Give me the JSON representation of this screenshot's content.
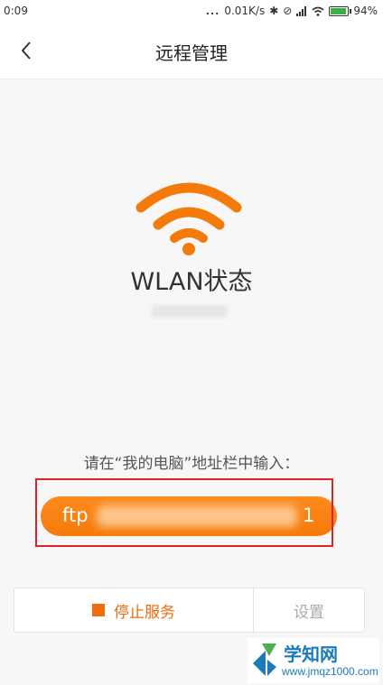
{
  "status_bar": {
    "time": "0:09",
    "dots": "...",
    "network_speed": "0.01K/s",
    "battery_percent": "94%",
    "battery_level": 0.94
  },
  "header": {
    "title": "远程管理"
  },
  "wlan": {
    "title": "WLAN状态"
  },
  "instruction": "请在“我的电脑”地址栏中输入：",
  "ftp": {
    "prefix": "ftp",
    "suffix": "1"
  },
  "actions": {
    "stop_label": "停止服务",
    "settings_label": "设置"
  },
  "watermark": {
    "text": "学知网",
    "url": "www.jmqz1000.com"
  },
  "colors": {
    "accent": "#f47a0a",
    "highlight": "#d9242a",
    "watermark": "#1b7bb8"
  }
}
